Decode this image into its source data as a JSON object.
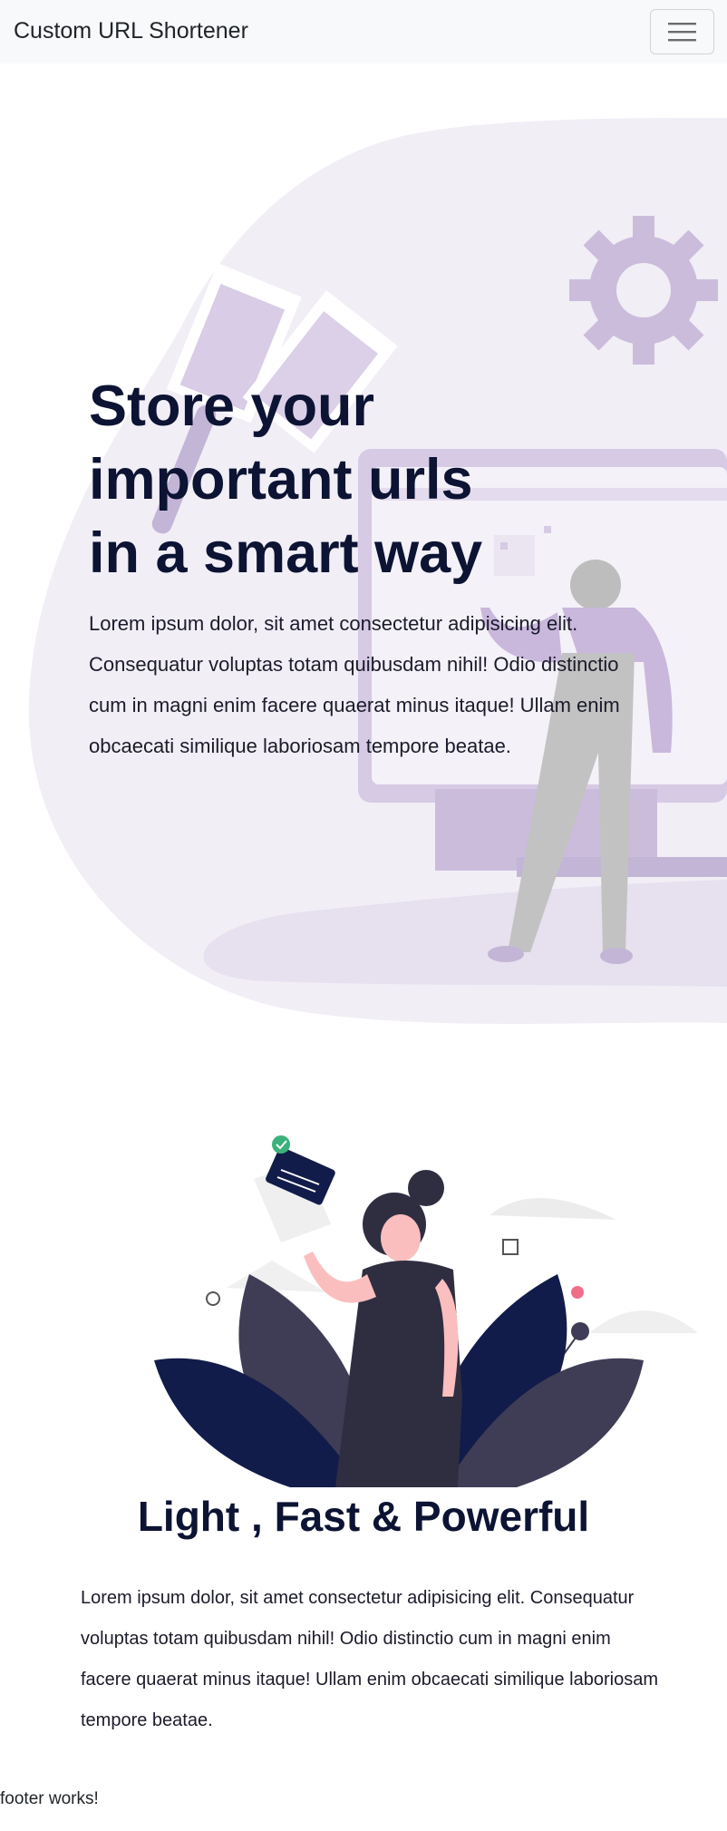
{
  "navbar": {
    "brand": "Custom URL Shortener",
    "toggle_icon": "hamburger-icon"
  },
  "hero": {
    "title_lines": [
      "Store your",
      "important urls",
      "in a smart way"
    ],
    "description": "Lorem ipsum dolor, sit amet consectetur adipisicing elit. Consequatur voluptas totam quibusdam nihil! Odio distinctio cum in magni enim facere quaerat minus itaque! Ullam enim obcaecati similique laboriosam tempore beatae.",
    "illustration": "person-at-monitor-illustration"
  },
  "feature": {
    "title": "Light , Fast & Powerful",
    "description": "Lorem ipsum dolor, sit amet consectetur adipisicing elit. Consequatur voluptas totam quibusdam nihil! Odio distinctio cum in magni enim facere quaerat minus itaque! Ullam enim obcaecati similique laboriosam tempore beatae.",
    "illustration": "woman-with-leaves-illustration"
  },
  "footer": {
    "text": "footer works!"
  },
  "colors": {
    "navbar_bg": "#f8f9fa",
    "heading": "#0c1333",
    "blob": "#f1eef6",
    "accent_purple": "#cbbcdc"
  }
}
